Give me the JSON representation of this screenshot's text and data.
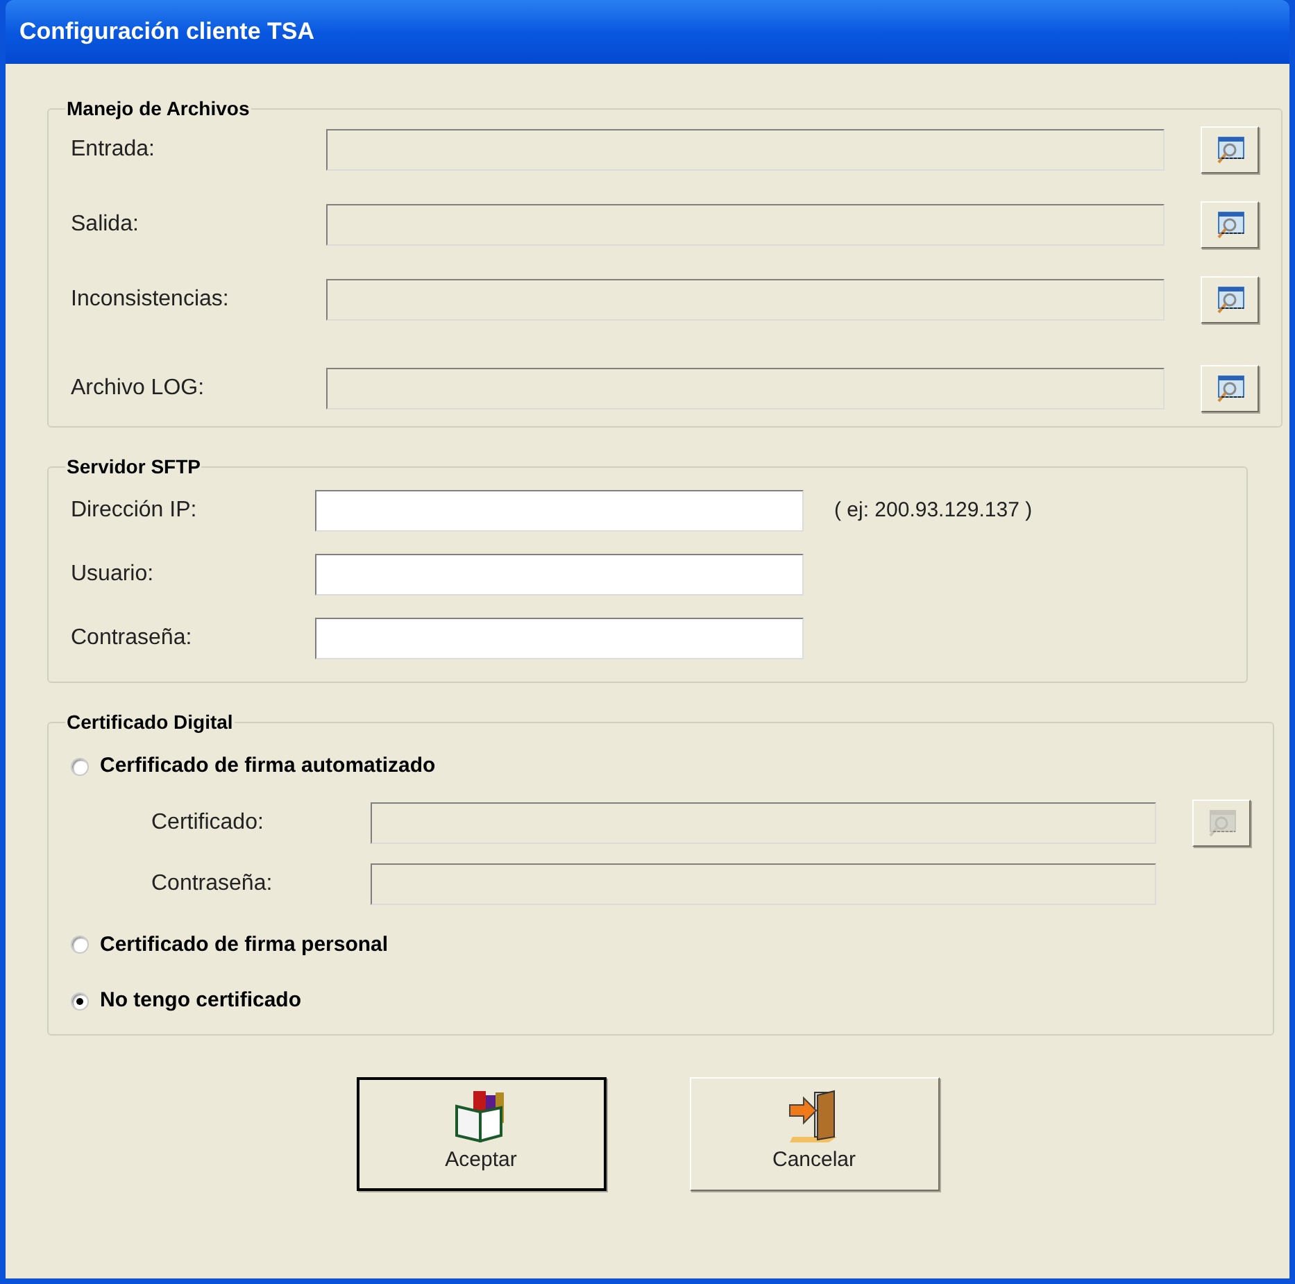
{
  "window": {
    "title": "Configuración cliente TSA"
  },
  "file_handling": {
    "title": "Manejo de Archivos",
    "rows": [
      {
        "label": "Entrada:",
        "disabled": true,
        "browse_disabled": false
      },
      {
        "label": "Salida:",
        "disabled": true,
        "browse_disabled": false
      },
      {
        "label": "Inconsistencias:",
        "disabled": true,
        "browse_disabled": false
      },
      {
        "label": "Archivo LOG:",
        "disabled": true,
        "browse_disabled": false
      }
    ]
  },
  "sftp_server": {
    "title": "Servidor SFTP",
    "rows": [
      {
        "label": "Dirección IP:",
        "hint": "( ej: 200.93.129.137 )"
      },
      {
        "label": "Usuario:"
      },
      {
        "label": "Contraseña:"
      }
    ]
  },
  "digital_certificate": {
    "title": "Certificado Digital",
    "options": [
      {
        "label": "Cerfificado de firma automatizado",
        "selected": false,
        "fields": [
          {
            "label": "Certificado:",
            "browse": true,
            "disabled": true
          },
          {
            "label": "Contraseña:",
            "browse": false,
            "disabled": true
          }
        ]
      },
      {
        "label": "Certificado de firma personal",
        "selected": false
      },
      {
        "label": "No tengo certificado",
        "selected": true
      }
    ]
  },
  "buttons": [
    {
      "label": "Aceptar",
      "kind": "accept",
      "default": true
    },
    {
      "label": "Cancelar",
      "kind": "cancel",
      "default": false
    }
  ]
}
